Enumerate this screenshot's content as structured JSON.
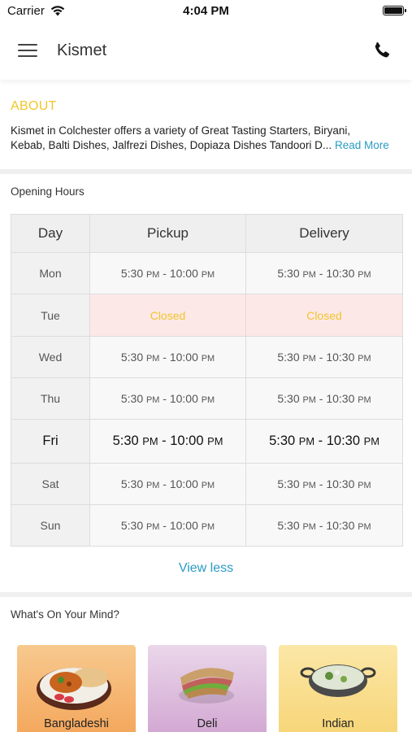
{
  "status_bar": {
    "carrier": "Carrier",
    "time": "4:04 PM"
  },
  "header": {
    "title": "Kismet",
    "menu_icon": "hamburger-menu-icon",
    "call_icon": "phone-icon"
  },
  "about": {
    "heading": "ABOUT",
    "text_line1": "Kismet in Colchester offers a variety of Great Tasting Starters, Biryani,",
    "text_line2": "Kebab, Balti Dishes, Jalfrezi Dishes, Dopiaza Dishes Tandoori D...",
    "read_more": "Read More"
  },
  "opening_hours": {
    "label": "Opening Hours",
    "columns": {
      "day": "Day",
      "pickup": "Pickup",
      "delivery": "Delivery"
    },
    "rows": [
      {
        "day": "Mon",
        "pickup": {
          "from": "5:30",
          "from_ampm": "PM",
          "to": "10:00",
          "to_ampm": "PM"
        },
        "delivery": {
          "from": "5:30",
          "from_ampm": "PM",
          "to": "10:30",
          "to_ampm": "PM"
        }
      },
      {
        "day": "Tue",
        "pickup_closed": "Closed",
        "delivery_closed": "Closed"
      },
      {
        "day": "Wed",
        "pickup": {
          "from": "5:30",
          "from_ampm": "PM",
          "to": "10:00",
          "to_ampm": "PM"
        },
        "delivery": {
          "from": "5:30",
          "from_ampm": "PM",
          "to": "10:30",
          "to_ampm": "PM"
        }
      },
      {
        "day": "Thu",
        "pickup": {
          "from": "5:30",
          "from_ampm": "PM",
          "to": "10:00",
          "to_ampm": "PM"
        },
        "delivery": {
          "from": "5:30",
          "from_ampm": "PM",
          "to": "10:30",
          "to_ampm": "PM"
        }
      },
      {
        "day": "Fri",
        "pickup": {
          "from": "5:30",
          "from_ampm": "PM",
          "to": "10:00",
          "to_ampm": "PM"
        },
        "delivery": {
          "from": "5:30",
          "from_ampm": "PM",
          "to": "10:30",
          "to_ampm": "PM"
        }
      },
      {
        "day": "Sat",
        "pickup": {
          "from": "5:30",
          "from_ampm": "PM",
          "to": "10:00",
          "to_ampm": "PM"
        },
        "delivery": {
          "from": "5:30",
          "from_ampm": "PM",
          "to": "10:30",
          "to_ampm": "PM"
        }
      },
      {
        "day": "Sun",
        "pickup": {
          "from": "5:30",
          "from_ampm": "PM",
          "to": "10:00",
          "to_ampm": "PM"
        },
        "delivery": {
          "from": "5:30",
          "from_ampm": "PM",
          "to": "10:30",
          "to_ampm": "PM"
        }
      }
    ],
    "view_less": "View less"
  },
  "mind": {
    "label": "What's On Your Mind?",
    "categories": [
      {
        "label": "Bangladeshi",
        "icon": "curry-plate-icon"
      },
      {
        "label": "Deli",
        "icon": "sandwich-icon"
      },
      {
        "label": "Indian",
        "icon": "karahi-dish-icon"
      }
    ]
  },
  "colors": {
    "accent": "#f0c62a",
    "link": "#2a9cc3",
    "closed_bg": "#fde8e8"
  }
}
